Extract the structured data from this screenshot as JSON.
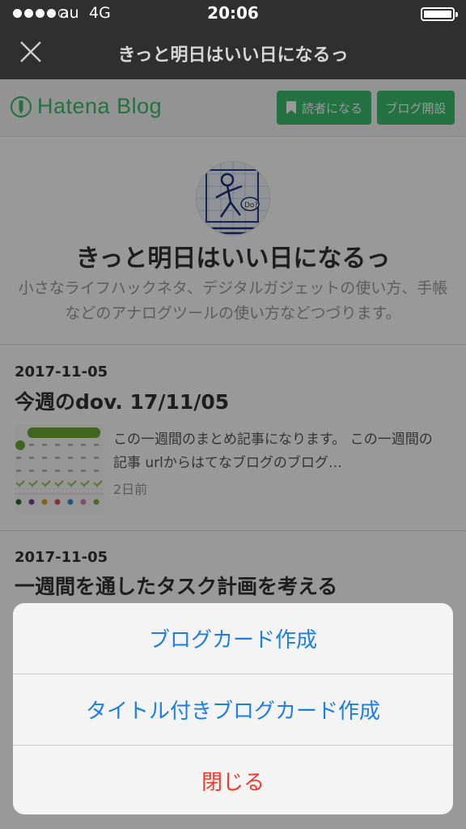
{
  "status_bar": {
    "carrier": "au",
    "network": "4G",
    "time": "20:06",
    "battery_level": 1.0
  },
  "nav": {
    "title": "きっと明日はいい日になるっ",
    "close_icon": "close-icon"
  },
  "blog_header": {
    "logo_text": "Hatena Blog",
    "subscribe_label": "読者になる",
    "open_blog_label": "ブログ開設",
    "accent_color": "#3dbd6e"
  },
  "blog": {
    "title": "きっと明日はいい日になるっ",
    "description": "小さなライフハックネタ、デジタルガジェットの使い方、手帳などのアナログツールの使い方などつづります。"
  },
  "posts": [
    {
      "date": "2017-11-05",
      "title": "今週のdov. 17/11/05",
      "excerpt": "この一週間のまとめ記事になります。 この一週間の記事 urlからはてなブログのブログ…",
      "age": "2日前"
    },
    {
      "date": "2017-11-05",
      "title": "一週間を通したタスク計画を考える"
    }
  ],
  "action_sheet": {
    "items": [
      {
        "label": "ブログカード作成",
        "color": "#1d7de9"
      },
      {
        "label": "タイトル付きブログカード作成",
        "color": "#1d7de9"
      },
      {
        "label": "閉じる",
        "color": "#f23b2f"
      }
    ]
  }
}
